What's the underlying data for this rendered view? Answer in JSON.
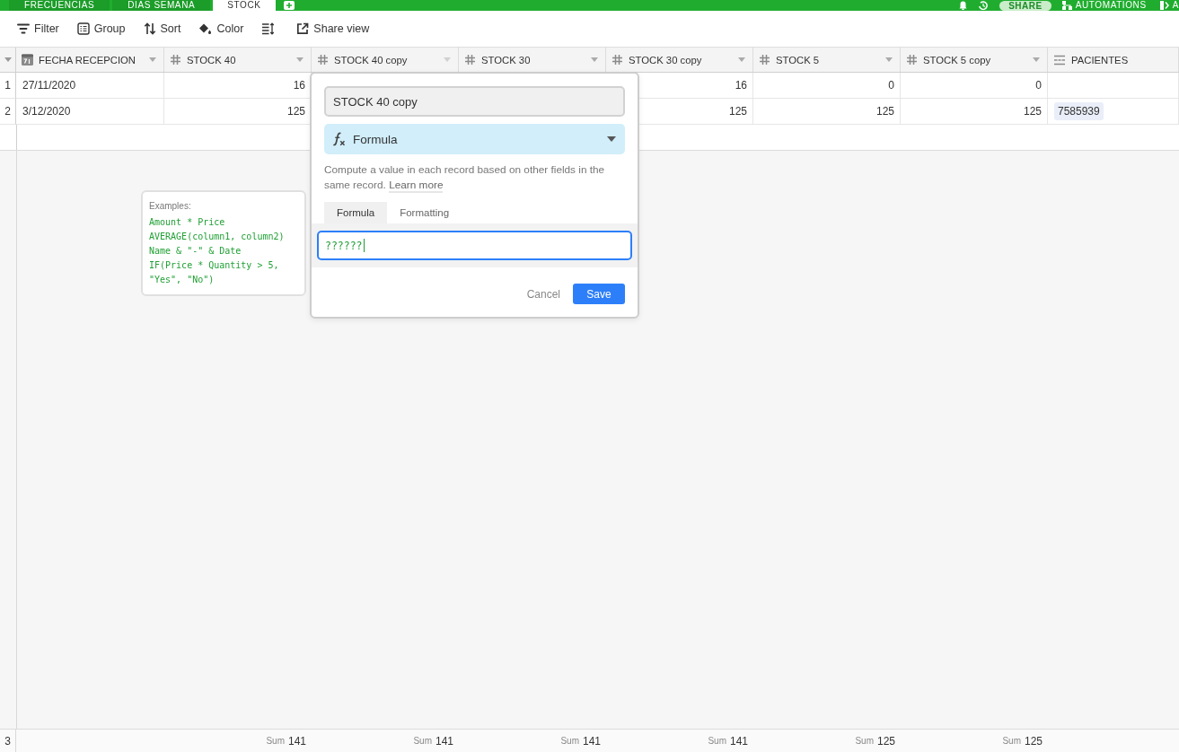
{
  "base_tabs": [
    {
      "label": "FRECUENCIAS",
      "selected": false
    },
    {
      "label": "DIAS SEMANA",
      "selected": false
    },
    {
      "label": "STOCK",
      "selected": true
    }
  ],
  "header_actions": {
    "share": "SHARE",
    "automations": "AUTOMATIONS",
    "apps": "A"
  },
  "toolbar": [
    {
      "kind": "filter",
      "label": "Filter"
    },
    {
      "kind": "group",
      "label": "Group"
    },
    {
      "kind": "sort",
      "label": "Sort"
    },
    {
      "kind": "color",
      "label": "Color"
    },
    {
      "kind": "row_height"
    },
    {
      "kind": "share_view",
      "label": "Share view"
    }
  ],
  "table": {
    "columns": [
      {
        "name": "FECHA RECEPCION",
        "kind": "date"
      },
      {
        "name": "STOCK 40",
        "kind": "number"
      },
      {
        "name": "STOCK 40 copy",
        "kind": "number"
      },
      {
        "name": "STOCK 30",
        "kind": "number"
      },
      {
        "name": "STOCK 30 copy",
        "kind": "number"
      },
      {
        "name": "STOCK 5",
        "kind": "number"
      },
      {
        "name": "STOCK 5 copy",
        "kind": "number"
      },
      {
        "name": "PACIENTES",
        "kind": "link"
      }
    ],
    "rows": [
      {
        "kind": "record",
        "number": "1",
        "cells": [
          "27/11/2020",
          "16",
          null,
          null,
          "16",
          "0",
          "0",
          null
        ]
      },
      {
        "kind": "record",
        "number": "2",
        "cells": [
          "3/12/2020",
          "125",
          null,
          null,
          "125",
          "125",
          "125",
          "7585939"
        ]
      },
      {
        "kind": "summary",
        "number": "3",
        "cells": [
          null,
          {
            "label": "Sum",
            "value": "141"
          },
          {
            "label": "Sum",
            "value": "141"
          },
          {
            "label": "Sum",
            "value": "141"
          },
          {
            "label": "Sum",
            "value": "141"
          },
          {
            "label": "Sum",
            "value": "125"
          },
          {
            "label": "Sum",
            "value": "125"
          },
          null
        ]
      }
    ]
  },
  "field_editor": {
    "name_value": "STOCK 40 copy",
    "field_type": "Formula",
    "description": "Compute a value in each record based on other fields in the same record.",
    "learn_more": "Learn more",
    "tabs": [
      {
        "label": "Formula",
        "selected": true
      },
      {
        "label": "Formatting",
        "selected": false
      }
    ],
    "formula_value": "??????",
    "cancel": "Cancel",
    "save": "Save"
  },
  "formula_examples": {
    "title": "Examples:",
    "lines": [
      "Amount * Price",
      "AVERAGE(column1, column2)",
      "Name & \"-\" & Date",
      "IF(Price * Quantity > 5, \"Yes\", \"No\")"
    ]
  }
}
